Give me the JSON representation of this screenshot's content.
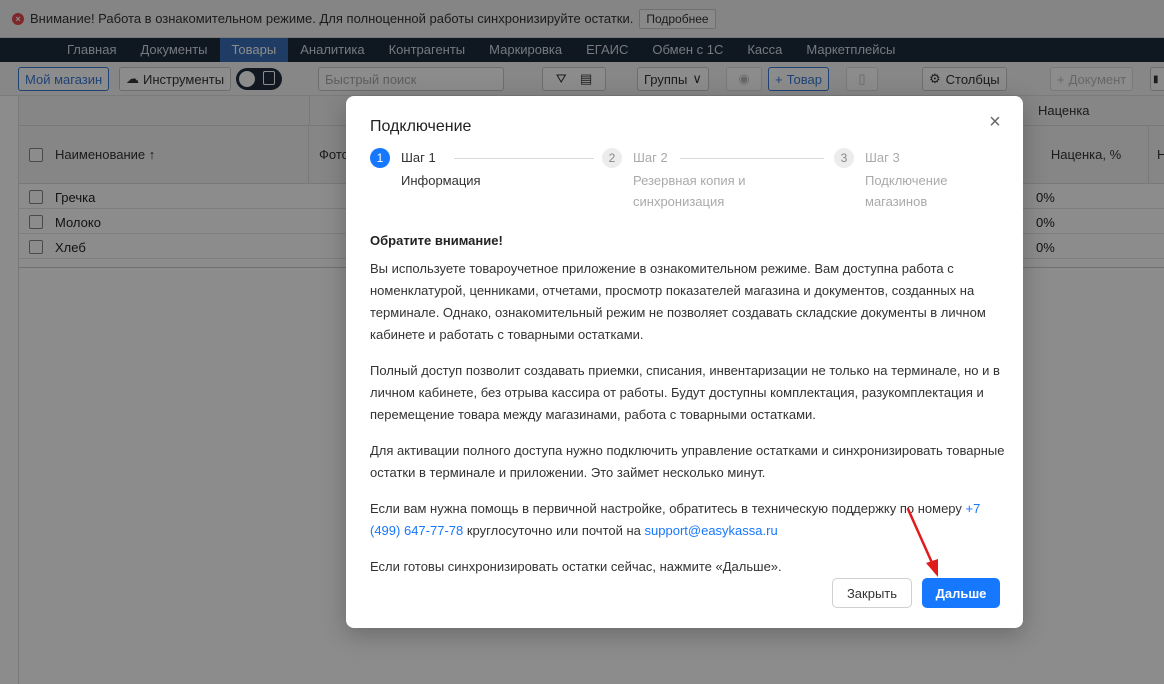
{
  "warning": {
    "text": "Внимание! Работа в ознакомительном режиме. Для полноценной работы синхронизируйте остатки.",
    "more_label": "Подробнее"
  },
  "nav": {
    "items": [
      "Главная",
      "Документы",
      "Товары",
      "Аналитика",
      "Контрагенты",
      "Маркировка",
      "ЕГАИС",
      "Обмен с 1С",
      "Касса",
      "Маркетплейсы"
    ],
    "active_index": 2
  },
  "toolbar": {
    "my_store": "Мой магазин",
    "tools": "Инструменты",
    "search_placeholder": "Быстрый поиск",
    "groups": "Группы",
    "add_product": "Товар",
    "columns": "Столбцы",
    "add_document": "Документ"
  },
  "table": {
    "group_header": "Наценка",
    "col_name": "Наименование ↑",
    "col_photo": "Фото",
    "col_markup": "Наценка, %",
    "col_next": "Н",
    "rows": [
      {
        "name": "Гречка",
        "markup": "0%"
      },
      {
        "name": "Молоко",
        "markup": "0%"
      },
      {
        "name": "Хлеб",
        "markup": "0%"
      }
    ]
  },
  "modal": {
    "title": "Подключение",
    "steps": [
      {
        "num": "1",
        "label": "Шаг 1",
        "sub1": "Информация",
        "sub2": "",
        "sub3": ""
      },
      {
        "num": "2",
        "label": "Шаг 2",
        "sub1": "Резервная копия и",
        "sub2": "синхронизация",
        "sub3": ""
      },
      {
        "num": "3",
        "label": "Шаг 3",
        "sub1": "Подключение",
        "sub2": "магазинов",
        "sub3": ""
      }
    ],
    "heading": "Обратите внимание!",
    "p1": "Вы используете товароучетное приложение в ознакомительном режиме. Вам доступна работа с номенклатурой, ценниками, отчетами, просмотр показателей магазина и документов, созданных на терминале. Однако, ознакомительный режим не позволяет создавать складские документы в личном кабинете и работать с товарными остатками.",
    "p2": "Полный доступ позволит создавать приемки, списания, инвентаризации не только на терминале, но и в личном кабинете, без отрыва кассира от работы. Будут доступны комплектация, разукомплектация и перемещение товара между магазинами, работа с товарными остатками.",
    "p3": "Для активации полного доступа нужно подключить управление остатками и синхронизировать товарные остатки в терминале и приложении. Это займет несколько минут.",
    "p4_before": "Если вам нужна помощь в первичной настройке, обратитесь в техническую поддержку по номеру",
    "phone": "+7 (499) 647-77-78",
    "p4_middle": "круглосуточно или почтой на",
    "email": "support@easykassa.ru",
    "p5": "Если готовы синхронизировать остатки сейчас, нажмите «Дальше».",
    "close_label": "Закрыть",
    "next_label": "Дальше"
  },
  "colors": {
    "primary": "#1677ff",
    "nav_bg": "#1c2a3d",
    "nav_active": "#3a6db7",
    "warning_icon": "#e5484d",
    "annotation_arrow": "#e01b1b"
  }
}
